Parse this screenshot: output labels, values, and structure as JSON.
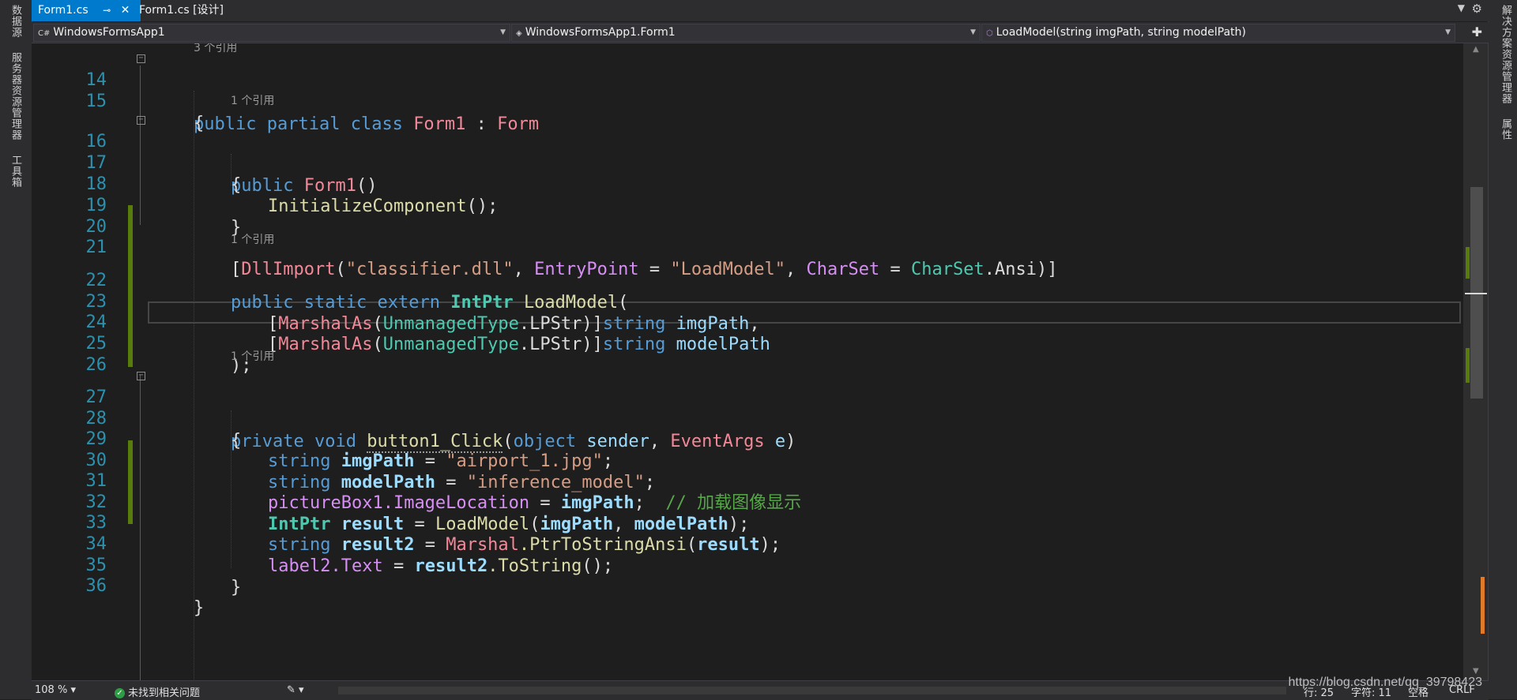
{
  "left_sidebar": {
    "tabs": [
      "数据源",
      "服务器资源管理器",
      "工具箱"
    ]
  },
  "right_sidebar": {
    "tabs": [
      "解决方案资源管理器",
      "属性"
    ]
  },
  "tabs": [
    {
      "label": "Form1.cs",
      "active": true
    },
    {
      "label": "Form1.cs [设计]",
      "active": false
    }
  ],
  "navbar": {
    "project": "WindowsFormsApp1",
    "class": "WindowsFormsApp1.Form1",
    "member": "LoadModel(string imgPath, string modelPath)"
  },
  "code_lens": {
    "three_refs": "3 个引用",
    "one_ref": "1 个引用"
  },
  "lines": {
    "l14": "14",
    "l15": "15",
    "l16": "16",
    "l17": "17",
    "l18": "18",
    "l19": "19",
    "l20": "20",
    "l21": "21",
    "l22": "22",
    "l23": "23",
    "l24": "24",
    "l25": "25",
    "l26": "26",
    "l27": "27",
    "l28": "28",
    "l29": "29",
    "l30": "30",
    "l31": "31",
    "l32": "32",
    "l33": "33",
    "l34": "34",
    "l35": "35",
    "l36": "36"
  },
  "tokens": {
    "kw_public": "public",
    "kw_partial": "partial",
    "kw_class": "class",
    "Form1": "Form1",
    "colon": " : ",
    "Form": "Form",
    "open_brace": "{",
    "close_brace": "}",
    "Form1_ctor": "Form1",
    "parens": "()",
    "InitializeComponent": "InitializeComponent",
    "call_end": "();",
    "DllImport": "DllImport",
    "dll_name": "\"classifier.dll\"",
    "EntryPoint": "EntryPoint",
    "entry_value": "\"LoadModel\"",
    "CharSet": "CharSet",
    "CharSet_type": "CharSet",
    "Ansi": ".Ansi",
    "kw_static": "static",
    "kw_extern": "extern",
    "IntPtr": "IntPtr",
    "LoadModel": "LoadModel",
    "MarshalAs": "MarshalAs",
    "UnmanagedType": "UnmanagedType",
    "LPStr": ".LPStr",
    "kw_string": "string",
    "imgPath": "imgPath",
    "modelPath": "modelPath",
    "close_paren_semi": ");",
    "kw_private": "private",
    "kw_void": "void",
    "button1_Click": "button1_Click",
    "kw_object": "object",
    "sender": "sender",
    "EventArgs": "EventArgs",
    "e": "e",
    "img_value": "\"airport_1.jpg\"",
    "model_value": "\"inference_model\"",
    "pictureBox1": "pictureBox1",
    "ImageLocation": ".ImageLocation",
    "comment": "// 加载图像显示",
    "result": "result",
    "result2": "result2",
    "Marshal": "Marshal",
    "PtrToStringAnsi": ".PtrToStringAnsi",
    "label2": "label2",
    "Text": ".Text",
    "ToString": ".ToString"
  },
  "status": {
    "zoom": "108 %",
    "issues": "未找到相关问题",
    "line": "行: 25",
    "char": "字符: 11",
    "spaces": "空格",
    "eol": "CRLF"
  },
  "watermark": "https://blog.csdn.net/qq_39798423",
  "colors": {
    "accent": "#007acc",
    "keyword": "#569cd6",
    "type": "#4ec9b0",
    "method": "#dcdcaa",
    "string": "#d69d85",
    "comment": "#57a64a",
    "change_marker": "#587c0c"
  }
}
